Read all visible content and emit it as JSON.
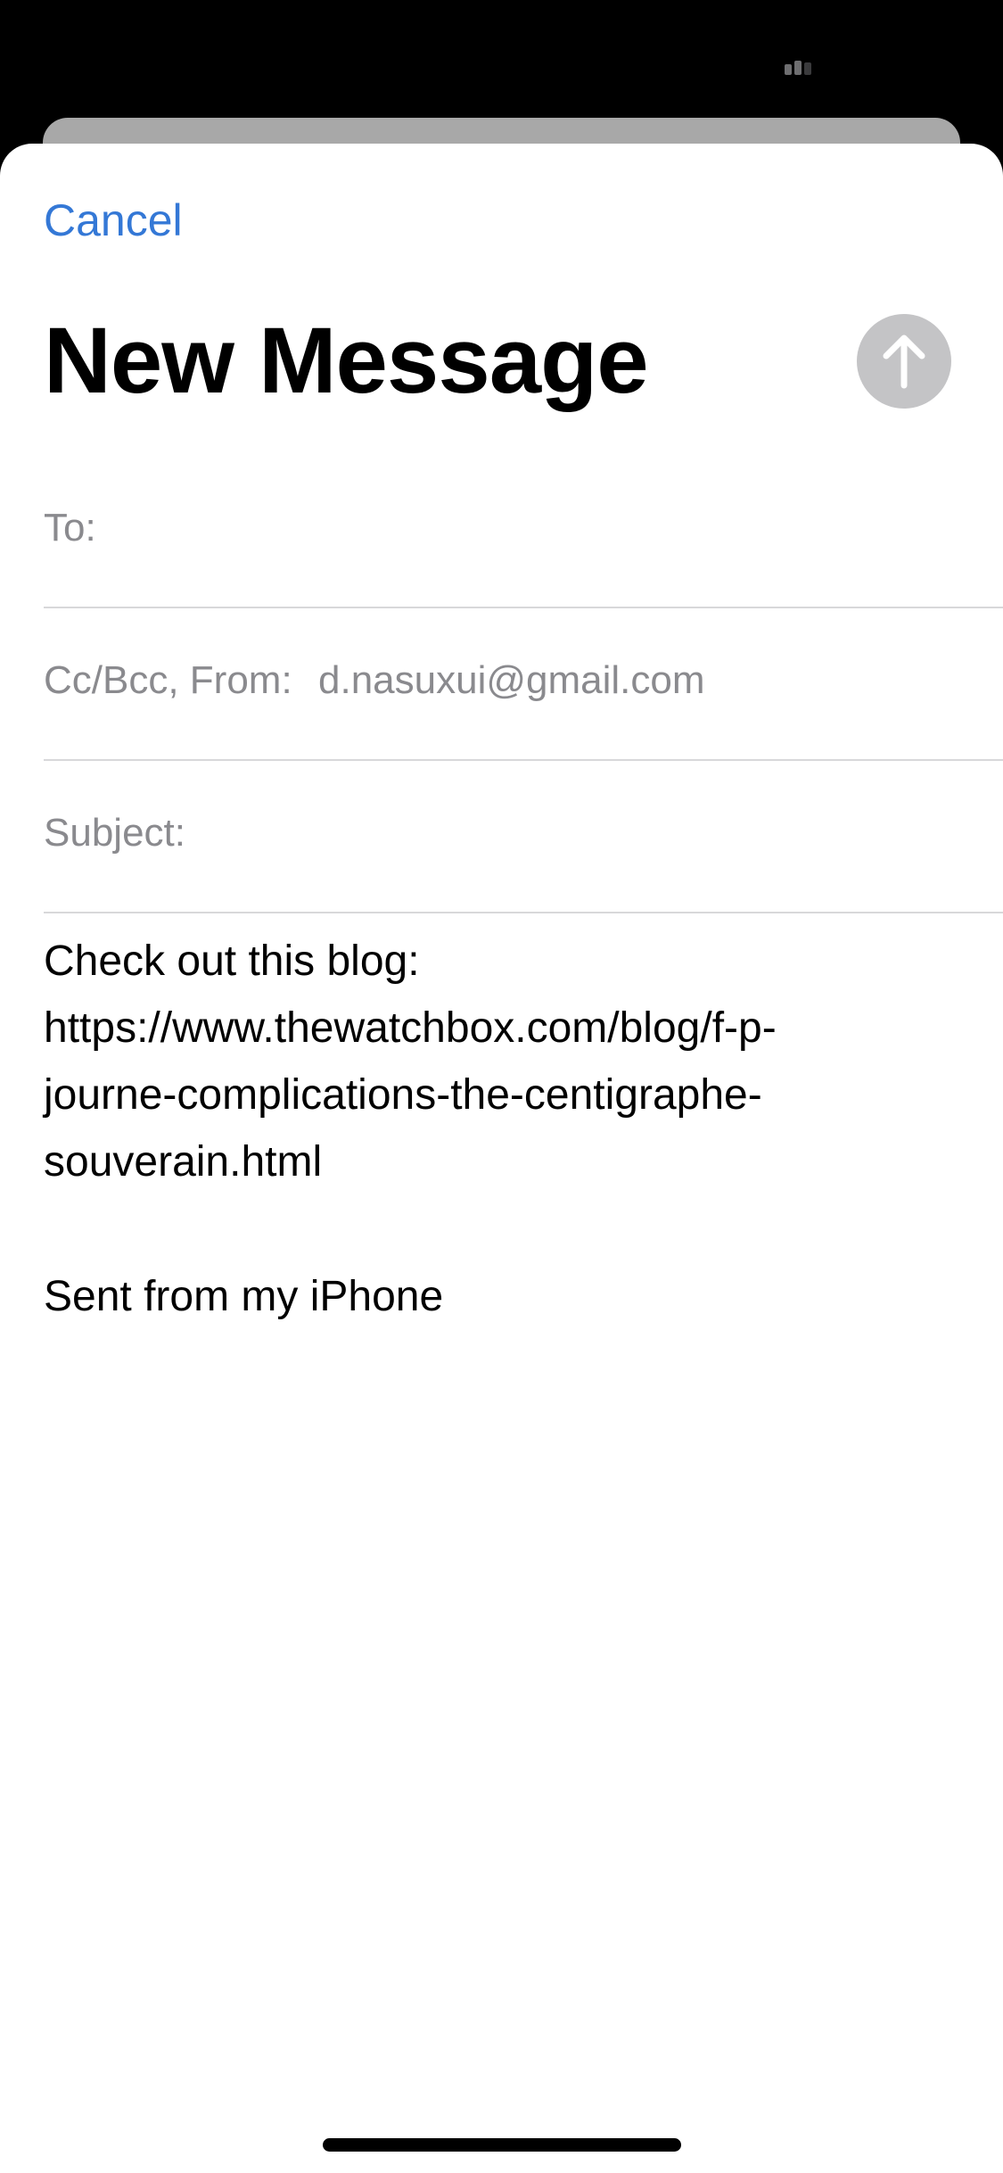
{
  "header": {
    "cancel_label": "Cancel",
    "title": "New Message"
  },
  "fields": {
    "to_label": "To:",
    "to_value": "",
    "ccbcc_label": "Cc/Bcc, From:",
    "from_value": "d.nasuxui@gmail.com",
    "subject_label": "Subject:",
    "subject_value": ""
  },
  "body": {
    "line1": "Check out this blog:",
    "link_lines": [
      "https://www.thewatchbox.com/blog/f-p-",
      "journe-complications-the-centigraphe-",
      "souverain.html"
    ],
    "signature": "Sent from my iPhone"
  },
  "icons": {
    "send": "arrow-up-icon",
    "status": "signal-icon"
  },
  "colors": {
    "accent": "#3478d6",
    "send_disabled": "#c4c4c6",
    "label_gray": "#8a8a8e",
    "separator": "#d8d8da"
  }
}
